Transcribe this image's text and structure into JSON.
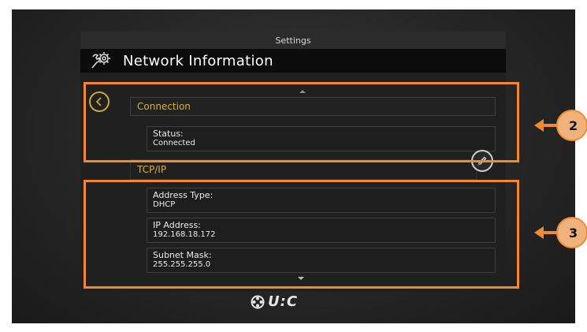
{
  "header": {
    "settings_title": "Settings",
    "page_title": "Network Information"
  },
  "connection": {
    "section_label": "Connection",
    "fields": [
      {
        "label": "Status:",
        "value": "Connected"
      }
    ]
  },
  "tcpip": {
    "section_label": "TCP/IP",
    "fields": [
      {
        "label": "Address Type:",
        "value": "DHCP"
      },
      {
        "label": "IP Address:",
        "value": "192.168.18.172"
      },
      {
        "label": "Subnet Mask:",
        "value": "255.255.255.0"
      }
    ]
  },
  "callouts": {
    "first": "2",
    "second": "3"
  },
  "brand": {
    "logo_text": "U:C"
  },
  "icons": {
    "gear": "settings-gears-icon",
    "back": "back-arrow-icon",
    "edit": "edit-pencil-icon",
    "scroll_up": "scroll-up-icon",
    "scroll_down": "scroll-down-icon"
  },
  "colors": {
    "accent_gold": "#d4b23a",
    "highlight_orange": "#ef8a33",
    "callout_fill": "#f0b27c"
  }
}
